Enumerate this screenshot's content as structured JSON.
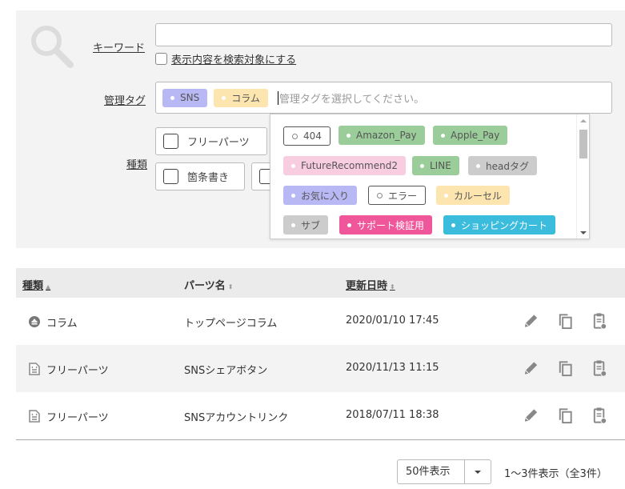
{
  "search": {
    "keyword_label": "キーワード",
    "keyword_value": "",
    "include_display_label": "表示内容を検索対象にする",
    "include_display_checked": false,
    "tag_label": "管理タグ",
    "selected_tags": [
      {
        "label": "SNS",
        "color": "#b8b8f5"
      },
      {
        "label": "コラム",
        "color": "#fde5b0"
      }
    ],
    "tag_placeholder": "管理タグを選択してください。",
    "kind_label": "種類",
    "kind_options": [
      {
        "label": "フリーパーツ",
        "checked": false
      },
      {
        "label": "箇条書き",
        "checked": false
      },
      {
        "label": "",
        "checked": false
      }
    ]
  },
  "tag_dropdown": {
    "options": [
      {
        "label": "404",
        "style": "outline"
      },
      {
        "label": "Amazon_Pay",
        "color": "#9acd9a"
      },
      {
        "label": "Apple_Pay",
        "color": "#9acd9a"
      },
      {
        "label": "FutureRecommend2",
        "color": "#f9cde0"
      },
      {
        "label": "LINE",
        "color": "#9acd9a"
      },
      {
        "label": "headタグ",
        "color": "#cccccc"
      },
      {
        "label": "お気に入り",
        "color": "#b8b8f5"
      },
      {
        "label": "エラー",
        "style": "outline"
      },
      {
        "label": "カルーセル",
        "color": "#fde5b0"
      },
      {
        "label": "サブ",
        "color": "#cccccc"
      },
      {
        "label": "サポート検証用",
        "color": "#f0569a",
        "text": "dark"
      },
      {
        "label": "ショッピングカート",
        "color": "#3bbcdc",
        "text": "dark"
      }
    ]
  },
  "table": {
    "columns": [
      {
        "label": "種類",
        "sort": "▲"
      },
      {
        "label": "パーツ名",
        "sort": "⬍"
      },
      {
        "label": "更新日時",
        "sort": "⬍"
      }
    ],
    "rows": [
      {
        "kind": "コラム",
        "kind_icon": "column-icon",
        "name": "トップページコラム",
        "updated": "2020/01/10 17:45"
      },
      {
        "kind": "フリーパーツ",
        "kind_icon": "free-parts-icon",
        "name": "SNSシェアボタン",
        "updated": "2020/11/13 11:15"
      },
      {
        "kind": "フリーパーツ",
        "kind_icon": "free-parts-icon",
        "name": "SNSアカウントリンク",
        "updated": "2018/07/11 18:38"
      }
    ],
    "row_actions": [
      "edit-icon",
      "copy-icon",
      "clipboard-settings-icon"
    ]
  },
  "pagination": {
    "per_page_selected": "50件表示",
    "summary": "1～3件表示（全3件）"
  }
}
